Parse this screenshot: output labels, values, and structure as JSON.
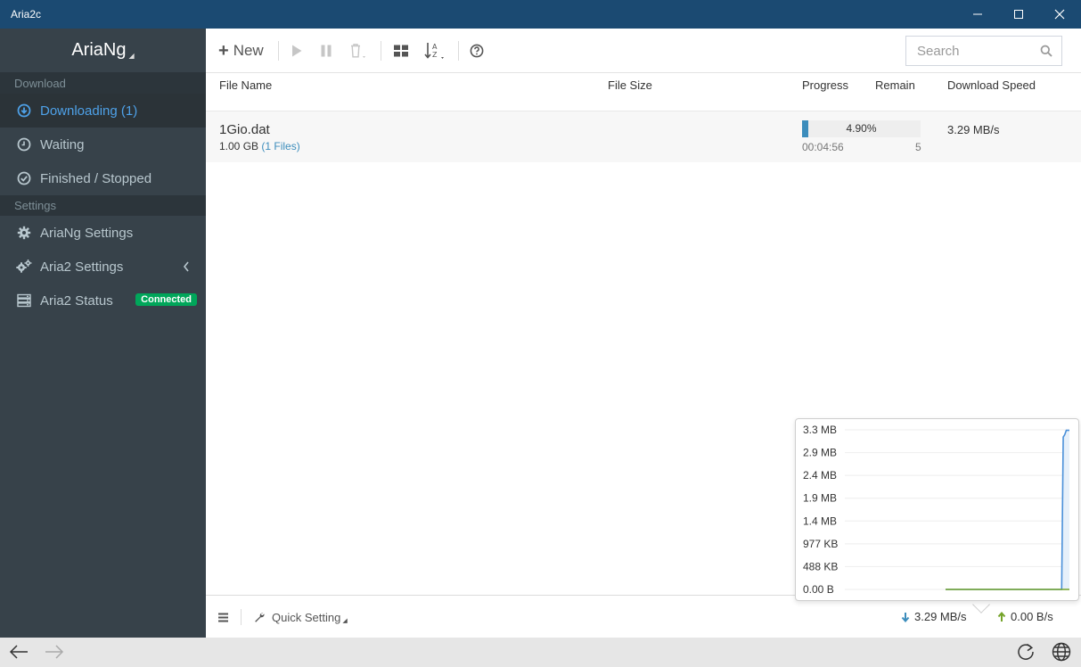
{
  "window": {
    "title": "Aria2c"
  },
  "sidebar": {
    "brand": "AriaNg",
    "sections": [
      {
        "title": "Download",
        "items": [
          {
            "label": "Downloading (1)",
            "icon": "arrow-circle-down-icon",
            "active": true
          },
          {
            "label": "Waiting",
            "icon": "clock-icon",
            "active": false
          },
          {
            "label": "Finished / Stopped",
            "icon": "check-circle-icon",
            "active": false
          }
        ]
      },
      {
        "title": "Settings",
        "items": [
          {
            "label": "AriaNg Settings",
            "icon": "gear-icon"
          },
          {
            "label": "Aria2 Settings",
            "icon": "gears-icon"
          },
          {
            "label": "Aria2 Status",
            "icon": "server-icon",
            "badge": "Connected"
          }
        ]
      }
    ]
  },
  "toolbar": {
    "new_label": "New",
    "search_placeholder": "Search"
  },
  "table": {
    "headers": {
      "file_name": "File Name",
      "file_size": "File Size",
      "progress": "Progress",
      "remain": "Remain",
      "download_speed": "Download Speed"
    },
    "rows": [
      {
        "name": "1Gio.dat",
        "size": "1.00 GB",
        "files": "(1 Files)",
        "progress_text": "4.90%",
        "progress_value": 4.9,
        "remaining_time": "00:04:56",
        "connections": "5",
        "speed": "3.29 MB/s"
      }
    ]
  },
  "footer": {
    "quick_setting": "Quick Setting",
    "download_speed": "3.29 MB/s",
    "upload_speed": "0.00 B/s"
  },
  "colors": {
    "accent": "#3c8dbc",
    "sidebar_bg": "#37424a",
    "titlebar_bg": "#1b4a72",
    "badge_green": "#00a65a",
    "upload_green": "#74a329"
  },
  "chart_data": {
    "type": "line",
    "title": "",
    "y_tick_labels": [
      "3.3 MB",
      "2.9 MB",
      "2.4 MB",
      "1.9 MB",
      "1.4 MB",
      "977 KB",
      "488 KB",
      "0.00 B"
    ],
    "ylim": [
      0,
      3.3
    ],
    "grid": true,
    "series": [
      {
        "color": "#4a90d9",
        "values": [
          0,
          0,
          0,
          0,
          0,
          0,
          0,
          0,
          0,
          0,
          0,
          0,
          0,
          0,
          0,
          0,
          0,
          0,
          0,
          0,
          0,
          0,
          0,
          0,
          0,
          0,
          0,
          0,
          0,
          0,
          0,
          0,
          0,
          0,
          0,
          0,
          0,
          0,
          0,
          0,
          0,
          0,
          0,
          0,
          0,
          0,
          0,
          0,
          0,
          0,
          0,
          0,
          0,
          0,
          0,
          0,
          0,
          0,
          0,
          0,
          0,
          0,
          0,
          0,
          0,
          0,
          0,
          0,
          0,
          0,
          0,
          0,
          0,
          0,
          0,
          0,
          3.15,
          3.2,
          3.29,
          3.29,
          3.29
        ]
      },
      {
        "color": "#74a329",
        "values": [
          0,
          0,
          0,
          0,
          0,
          0,
          0,
          0,
          0,
          0,
          0,
          0,
          0,
          0,
          0,
          0,
          0,
          0,
          0,
          0,
          0,
          0,
          0,
          0,
          0,
          0,
          0,
          0,
          0,
          0,
          0,
          0,
          0,
          0,
          0,
          0,
          0,
          0,
          0,
          0,
          0,
          0,
          0,
          0,
          0,
          0,
          0,
          0,
          0,
          0,
          0,
          0,
          0,
          0,
          0,
          0,
          0,
          0,
          0,
          0,
          0,
          0,
          0,
          0,
          0,
          0,
          0,
          0,
          0,
          0,
          0,
          0,
          0,
          0,
          0,
          0,
          0,
          0,
          0,
          0,
          0
        ]
      }
    ]
  }
}
